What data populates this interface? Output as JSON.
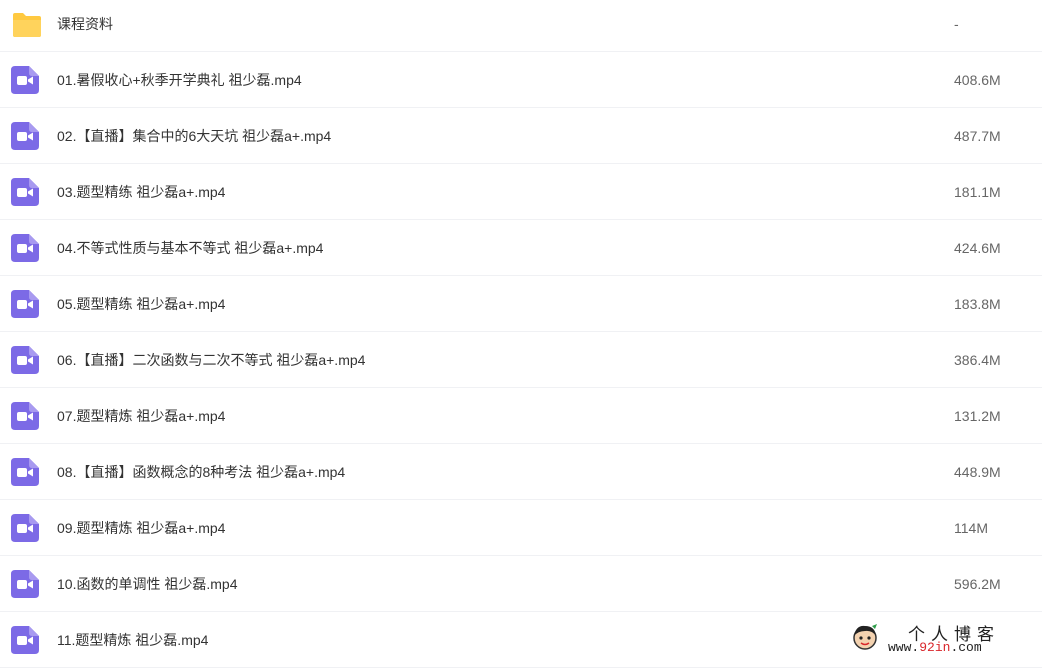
{
  "colors": {
    "folder": "#ffc940",
    "video_icon": "#7c6ae6",
    "divider": "#f0f1f4"
  },
  "folder": {
    "name": "课程资料",
    "size": "-",
    "icon": "folder-icon"
  },
  "files": [
    {
      "name": "01.暑假收心+秋季开学典礼 祖少磊.mp4",
      "size": "408.6M",
      "icon": "video-file-icon"
    },
    {
      "name": "02.【直播】集合中的6大天坑 祖少磊a+.mp4",
      "size": "487.7M",
      "icon": "video-file-icon"
    },
    {
      "name": "03.题型精练 祖少磊a+.mp4",
      "size": "181.1M",
      "icon": "video-file-icon"
    },
    {
      "name": "04.不等式性质与基本不等式 祖少磊a+.mp4",
      "size": "424.6M",
      "icon": "video-file-icon"
    },
    {
      "name": "05.题型精练 祖少磊a+.mp4",
      "size": "183.8M",
      "icon": "video-file-icon"
    },
    {
      "name": "06.【直播】二次函数与二次不等式 祖少磊a+.mp4",
      "size": "386.4M",
      "icon": "video-file-icon"
    },
    {
      "name": "07.题型精炼 祖少磊a+.mp4",
      "size": "131.2M",
      "icon": "video-file-icon"
    },
    {
      "name": "08.【直播】函数概念的8种考法 祖少磊a+.mp4",
      "size": "448.9M",
      "icon": "video-file-icon"
    },
    {
      "name": "09.题型精炼 祖少磊a+.mp4",
      "size": "114M",
      "icon": "video-file-icon"
    },
    {
      "name": "10.函数的单调性 祖少磊.mp4",
      "size": "596.2M",
      "icon": "video-file-icon"
    },
    {
      "name": "11.题型精炼 祖少磊.mp4",
      "size": "",
      "icon": "video-file-icon"
    }
  ],
  "watermark": {
    "title": "个人博客",
    "domain_prefix": "www.",
    "domain_accent": "92in",
    "domain_suffix": ".com",
    "icon": "blog-mascot-icon"
  }
}
